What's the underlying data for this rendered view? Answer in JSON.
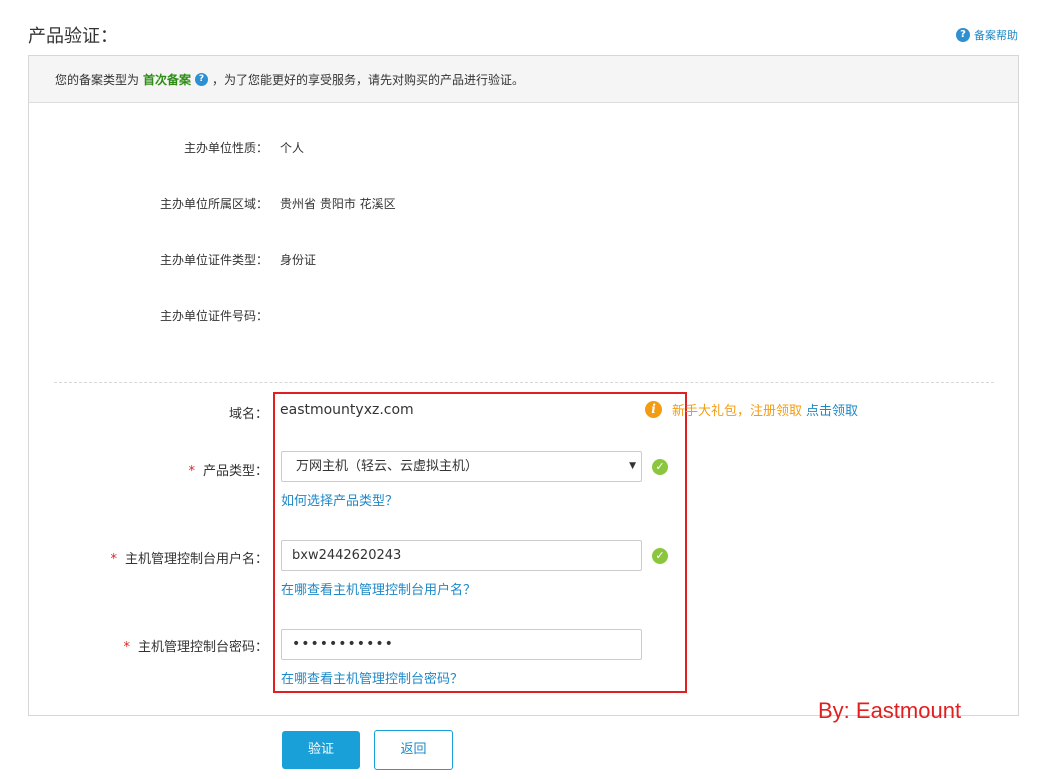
{
  "header": {
    "title": "产品验证：",
    "help_link": "备案帮助"
  },
  "notice": {
    "prefix": "您的备案类型为",
    "record_type": "首次备案",
    "suffix": "，为了您能更好的享受服务，请先对购买的产品进行验证。"
  },
  "info": [
    {
      "label": "主办单位性质：",
      "value": "个人"
    },
    {
      "label": "主办单位所属区域：",
      "value": "贵州省 贵阳市 花溪区"
    },
    {
      "label": "主办单位证件类型：",
      "value": "身份证"
    },
    {
      "label": "主办单位证件号码：",
      "value": ""
    }
  ],
  "form": {
    "domain_label": "域名：",
    "domain_value": "eastmountyxz.com",
    "tip_text": "新手大礼包，注册领取",
    "tip_link": "点击领取",
    "required_mark": "*",
    "product_type_label": "产品类型：",
    "product_type_value": "万网主机（轻云、云虚拟主机）",
    "product_type_help": "如何选择产品类型？",
    "username_label": "主机管理控制台用户名：",
    "username_value": "bxw2442620243",
    "username_help": "在哪查看主机管理控制台用户名？",
    "password_label": "主机管理控制台密码：",
    "password_value": "•••••••••••",
    "password_help": "在哪查看主机管理控制台密码？"
  },
  "byline": "By: Eastmount",
  "buttons": {
    "verify": "验证",
    "back": "返回"
  },
  "colors": {
    "accent": "#1aa0d8",
    "link": "#1e88c7",
    "required": "#e02020",
    "success": "#8cc63f",
    "warning": "#f39c12"
  },
  "icons": {
    "help": "question-circle-icon",
    "success": "check-circle-icon",
    "warning": "info-circle-icon",
    "dropdown": "caret-down-icon"
  }
}
